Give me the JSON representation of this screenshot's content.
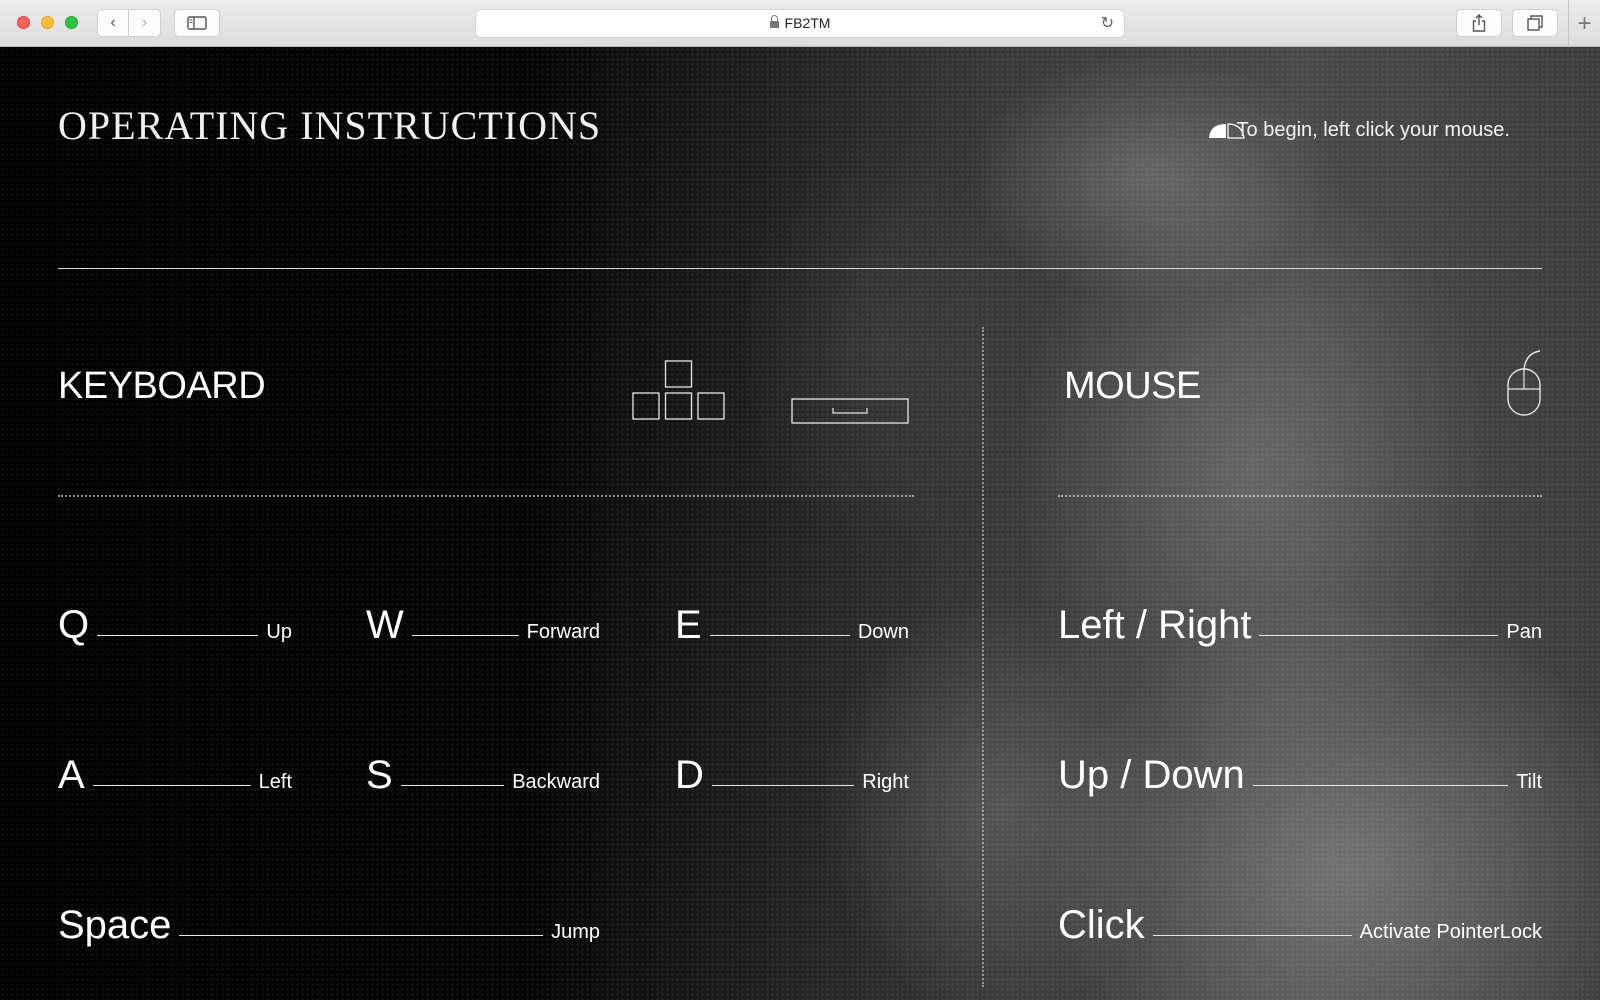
{
  "browser": {
    "url": "FB2TM",
    "back_icon": "‹",
    "forward_icon": "›",
    "reload_icon": "↻",
    "new_tab_icon": "+"
  },
  "header": {
    "title": "OPERATING INSTRUCTIONS",
    "begin_text": "To begin, left click your mouse."
  },
  "keyboard": {
    "title": "KEYBOARD",
    "controls": [
      {
        "key": "Q",
        "action": "Up"
      },
      {
        "key": "W",
        "action": "Forward"
      },
      {
        "key": "E",
        "action": "Down"
      },
      {
        "key": "A",
        "action": "Left"
      },
      {
        "key": "S",
        "action": "Backward"
      },
      {
        "key": "D",
        "action": "Right"
      },
      {
        "key": "Space",
        "action": "Jump"
      }
    ]
  },
  "mouse": {
    "title": "MOUSE",
    "controls": [
      {
        "key": "Left / Right",
        "action": "Pan"
      },
      {
        "key": "Up / Down",
        "action": "Tilt"
      },
      {
        "key": "Click",
        "action": "Activate PointerLock"
      }
    ]
  }
}
